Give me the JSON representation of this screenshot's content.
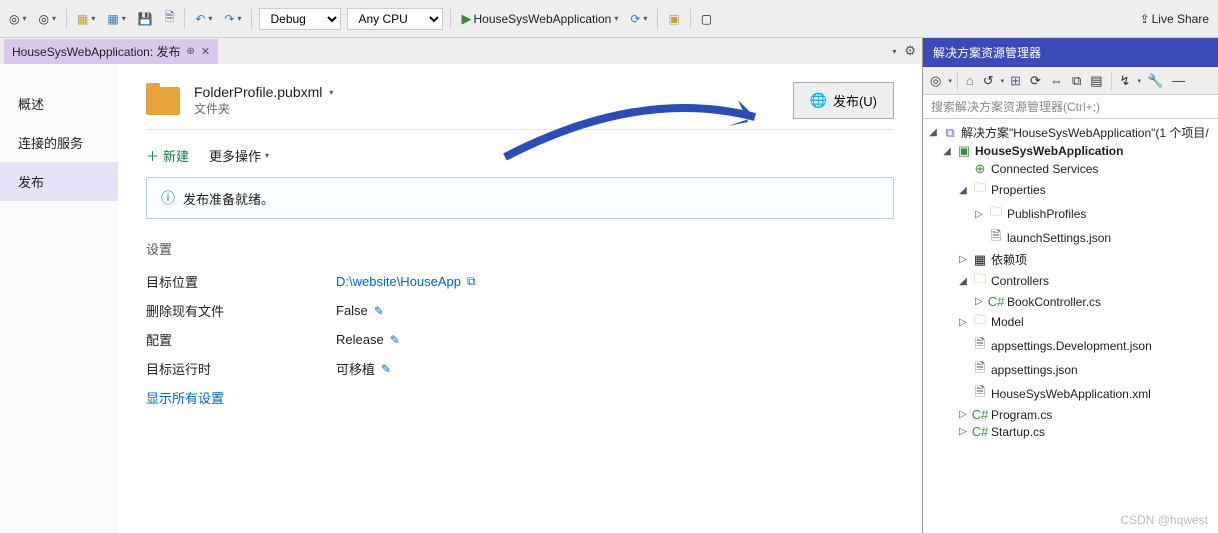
{
  "toolbar": {
    "debug": "Debug",
    "cpu": "Any CPU",
    "start_target": "HouseSysWebApplication",
    "live_share": "Live Share"
  },
  "tab": {
    "title": "HouseSysWebApplication: 发布"
  },
  "publish": {
    "nav": {
      "overview": "概述",
      "connected": "连接的服务",
      "publish": "发布"
    },
    "profile_name": "FolderProfile.pubxml",
    "profile_sub": "文件夹",
    "publish_btn": "发布(U)",
    "add": "新建",
    "more": "更多操作",
    "ready": "发布准备就绪。",
    "settings_title": "设置",
    "rows": {
      "target_loc_label": "目标位置",
      "target_loc_val": "D:\\website\\HouseApp",
      "delete_label": "删除现有文件",
      "delete_val": "False",
      "config_label": "配置",
      "config_val": "Release",
      "runtime_label": "目标运行时",
      "runtime_val": "可移植"
    },
    "show_all": "显示所有设置"
  },
  "solution_explorer": {
    "title": "解决方案资源管理器",
    "search_placeholder": "搜索解决方案资源管理器(Ctrl+;)",
    "root": "解决方案\"HouseSysWebApplication\"(1 个项目/",
    "project": "HouseSysWebApplication",
    "connected": "Connected Services",
    "properties": "Properties",
    "publish_profiles": "PublishProfiles",
    "launch_settings": "launchSettings.json",
    "deps": "依赖项",
    "controllers": "Controllers",
    "book_controller": "BookController.cs",
    "model": "Model",
    "appsettings_dev": "appsettings.Development.json",
    "appsettings": "appsettings.json",
    "xml": "HouseSysWebApplication.xml",
    "program": "Program.cs",
    "startup": "Startup.cs"
  },
  "watermark": "CSDN @hqwest"
}
